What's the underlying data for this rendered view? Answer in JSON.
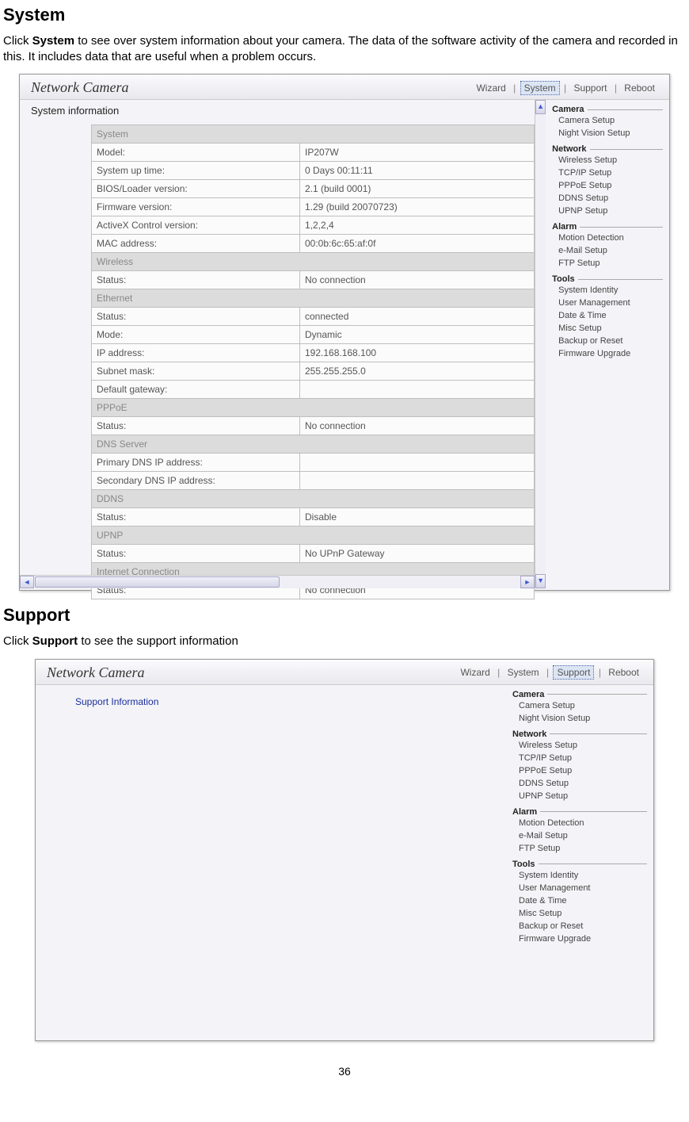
{
  "doc": {
    "heading1": "System",
    "para1_pre": "Click ",
    "para1_bold": "System",
    "para1_post": " to see over system information about your camera. The data of the software activity of the camera and recorded in this. It includes data that are useful when a problem occurs.",
    "heading2": "Support",
    "para2_pre": "Click ",
    "para2_bold": "Support",
    "para2_post": " to see the support information",
    "page_num": "36"
  },
  "shot1": {
    "brand": "Network Camera",
    "toplinks": {
      "wizard": "Wizard",
      "system": "System",
      "support": "Support",
      "reboot": "Reboot"
    },
    "panel_title": "System information",
    "rows": [
      {
        "section": "System"
      },
      {
        "label": "Model:",
        "value": "IP207W"
      },
      {
        "label": "System up time:",
        "value": "0 Days 00:11:11"
      },
      {
        "label": "BIOS/Loader version:",
        "value": "2.1 (build 0001)"
      },
      {
        "label": "Firmware version:",
        "value": "1.29 (build 20070723)"
      },
      {
        "label": "ActiveX Control version:",
        "value": "1,2,2,4"
      },
      {
        "label": "MAC address:",
        "value": "00:0b:6c:65:af:0f"
      },
      {
        "section": "Wireless"
      },
      {
        "label": "Status:",
        "value": "No connection"
      },
      {
        "section": "Ethernet"
      },
      {
        "label": "Status:",
        "value": "connected"
      },
      {
        "label": "Mode:",
        "value": "Dynamic"
      },
      {
        "label": "IP address:",
        "value": "192.168.168.100"
      },
      {
        "label": "Subnet mask:",
        "value": "255.255.255.0"
      },
      {
        "label": "Default gateway:",
        "value": ""
      },
      {
        "section": "PPPoE"
      },
      {
        "label": "Status:",
        "value": "No connection"
      },
      {
        "section": "DNS Server"
      },
      {
        "label": "Primary DNS IP address:",
        "value": ""
      },
      {
        "label": "Secondary DNS IP address:",
        "value": ""
      },
      {
        "section": "DDNS"
      },
      {
        "label": "Status:",
        "value": "Disable"
      },
      {
        "section": "UPNP"
      },
      {
        "label": "Status:",
        "value": "No UPnP Gateway"
      },
      {
        "section": "Internet Connection"
      },
      {
        "label": "Status:",
        "value": "No connection"
      }
    ]
  },
  "shot2": {
    "brand": "Network Camera",
    "toplinks": {
      "wizard": "Wizard",
      "system": "System",
      "support": "Support",
      "reboot": "Reboot"
    },
    "panel_title": "Support Information"
  },
  "sidebar": {
    "groups": [
      {
        "label": "Camera",
        "items": [
          "Camera Setup",
          "Night Vision Setup"
        ]
      },
      {
        "label": "Network",
        "items": [
          "Wireless Setup",
          "TCP/IP Setup",
          "PPPoE Setup",
          "DDNS Setup",
          "UPNP Setup"
        ]
      },
      {
        "label": "Alarm",
        "items": [
          "Motion Detection",
          "e-Mail Setup",
          "FTP Setup"
        ]
      },
      {
        "label": "Tools",
        "items": [
          "System Identity",
          "User Management",
          "Date & Time",
          "Misc Setup",
          "Backup or Reset",
          "Firmware Upgrade"
        ]
      }
    ]
  }
}
